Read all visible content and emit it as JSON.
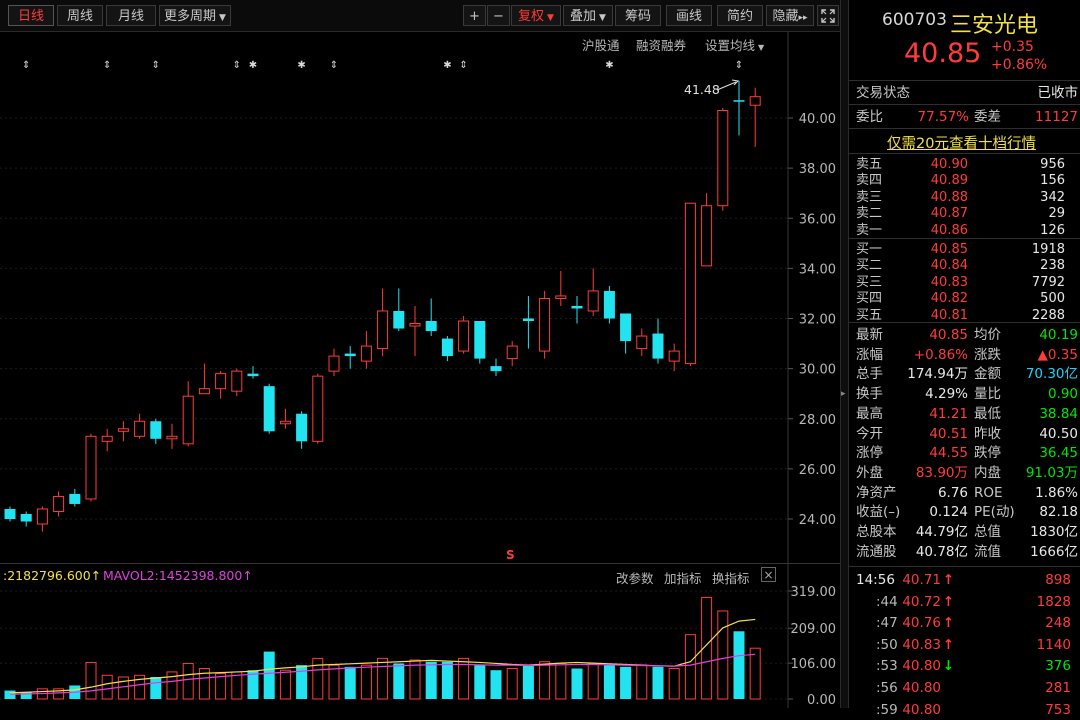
{
  "toolbar": {
    "tabs": [
      "日线",
      "周线",
      "月线",
      "更多周期"
    ],
    "plus": "+",
    "minus": "−",
    "adjust": "复权",
    "overlay": "叠加",
    "chips": "筹码",
    "draw": "画线",
    "simple": "简约",
    "hide": "隐藏",
    "more_arrow": "▸▸"
  },
  "chart_links": {
    "hsgt": "沪股通",
    "margin": "融资融券",
    "ma_settings": "设置均线"
  },
  "markers": {
    "up_arrow_glyph": "⇕",
    "star_glyph": "✱",
    "red_s": "S"
  },
  "volume": {
    "mavol1_label": ":2182796.600",
    "mavol2_label": "MAVOL2:1452398.800",
    "arrow": "↑",
    "params": "改参数",
    "add_indicator": "加指标",
    "switch_indicator": "换指标",
    "close": "×",
    "axis_labels": [
      "319.00",
      "209.00",
      "106.00",
      "0.00"
    ],
    "colors": {
      "ma1": "#f0e04a",
      "ma2": "#e040e0",
      "up": "#ff3b3b",
      "down": "#22e4f0"
    }
  },
  "chart_data": {
    "type": "candlestick",
    "y_axis_labels": [
      "40.00",
      "38.00",
      "36.00",
      "34.00",
      "32.00",
      "30.00",
      "28.00",
      "26.00",
      "24.00"
    ],
    "ylim": [
      23.0,
      42.0
    ],
    "high_annotation": "41.48",
    "candles": [
      {
        "o": 24.0,
        "c": 24.4,
        "h": 24.5,
        "l": 23.9,
        "dir": "down",
        "v": 25
      },
      {
        "o": 23.9,
        "c": 24.2,
        "h": 24.3,
        "l": 23.7,
        "dir": "down",
        "v": 20
      },
      {
        "o": 23.8,
        "c": 24.4,
        "h": 24.5,
        "l": 23.5,
        "dir": "up",
        "v": 30
      },
      {
        "o": 24.3,
        "c": 24.9,
        "h": 25.1,
        "l": 24.1,
        "dir": "up",
        "v": 30
      },
      {
        "o": 25.0,
        "c": 24.6,
        "h": 25.2,
        "l": 24.5,
        "dir": "down",
        "v": 40
      },
      {
        "o": 24.8,
        "c": 27.3,
        "h": 27.4,
        "l": 24.7,
        "dir": "up",
        "v": 108
      },
      {
        "o": 27.1,
        "c": 27.3,
        "h": 27.6,
        "l": 26.7,
        "dir": "up",
        "v": 70
      },
      {
        "o": 27.5,
        "c": 27.6,
        "h": 27.9,
        "l": 27.1,
        "dir": "up",
        "v": 65
      },
      {
        "o": 27.3,
        "c": 27.9,
        "h": 28.2,
        "l": 27.2,
        "dir": "up",
        "v": 70
      },
      {
        "o": 27.9,
        "c": 27.2,
        "h": 28.0,
        "l": 27.0,
        "dir": "down",
        "v": 65
      },
      {
        "o": 27.2,
        "c": 27.3,
        "h": 27.8,
        "l": 26.8,
        "dir": "up",
        "v": 80
      },
      {
        "o": 27.0,
        "c": 28.9,
        "h": 29.5,
        "l": 26.9,
        "dir": "up",
        "v": 105
      },
      {
        "o": 29.0,
        "c": 29.2,
        "h": 30.2,
        "l": 29.0,
        "dir": "up",
        "v": 90
      },
      {
        "o": 29.2,
        "c": 29.8,
        "h": 29.9,
        "l": 28.8,
        "dir": "up",
        "v": 75
      },
      {
        "o": 29.1,
        "c": 29.9,
        "h": 30.0,
        "l": 28.9,
        "dir": "up",
        "v": 80
      },
      {
        "o": 29.8,
        "c": 29.7,
        "h": 30.1,
        "l": 29.6,
        "dir": "down",
        "v": 85
      },
      {
        "o": 29.3,
        "c": 27.5,
        "h": 29.4,
        "l": 27.4,
        "dir": "down",
        "v": 140
      },
      {
        "o": 27.8,
        "c": 27.9,
        "h": 28.4,
        "l": 27.6,
        "dir": "up",
        "v": 85
      },
      {
        "o": 28.2,
        "c": 27.1,
        "h": 28.3,
        "l": 26.8,
        "dir": "down",
        "v": 100
      },
      {
        "o": 27.1,
        "c": 29.7,
        "h": 29.8,
        "l": 27.0,
        "dir": "up",
        "v": 120
      },
      {
        "o": 29.9,
        "c": 30.5,
        "h": 30.8,
        "l": 29.7,
        "dir": "up",
        "v": 100
      },
      {
        "o": 30.5,
        "c": 30.6,
        "h": 30.9,
        "l": 30.0,
        "dir": "down",
        "v": 95
      },
      {
        "o": 30.3,
        "c": 30.9,
        "h": 31.5,
        "l": 30.0,
        "dir": "up",
        "v": 100
      },
      {
        "o": 30.8,
        "c": 32.3,
        "h": 33.2,
        "l": 30.5,
        "dir": "up",
        "v": 120
      },
      {
        "o": 32.3,
        "c": 31.6,
        "h": 33.2,
        "l": 31.5,
        "dir": "down",
        "v": 105
      },
      {
        "o": 31.8,
        "c": 31.7,
        "h": 32.5,
        "l": 30.5,
        "dir": "up",
        "v": 115
      },
      {
        "o": 31.9,
        "c": 31.5,
        "h": 32.8,
        "l": 31.3,
        "dir": "down",
        "v": 110
      },
      {
        "o": 31.2,
        "c": 30.5,
        "h": 31.3,
        "l": 30.3,
        "dir": "down",
        "v": 110
      },
      {
        "o": 30.7,
        "c": 31.9,
        "h": 32.1,
        "l": 30.6,
        "dir": "up",
        "v": 120
      },
      {
        "o": 31.9,
        "c": 30.4,
        "h": 31.9,
        "l": 30.2,
        "dir": "down",
        "v": 100
      },
      {
        "o": 30.1,
        "c": 29.9,
        "h": 30.4,
        "l": 29.7,
        "dir": "down",
        "v": 85
      },
      {
        "o": 30.4,
        "c": 30.9,
        "h": 31.1,
        "l": 30.1,
        "dir": "up",
        "v": 90
      },
      {
        "o": 31.9,
        "c": 32.0,
        "h": 32.9,
        "l": 30.8,
        "dir": "down",
        "v": 100
      },
      {
        "o": 30.7,
        "c": 32.8,
        "h": 33.1,
        "l": 30.4,
        "dir": "up",
        "v": 110
      },
      {
        "o": 32.8,
        "c": 32.9,
        "h": 33.9,
        "l": 32.5,
        "dir": "up",
        "v": 105
      },
      {
        "o": 32.4,
        "c": 32.5,
        "h": 32.9,
        "l": 31.8,
        "dir": "down",
        "v": 90
      },
      {
        "o": 32.3,
        "c": 33.1,
        "h": 34.0,
        "l": 32.1,
        "dir": "up",
        "v": 105
      },
      {
        "o": 33.1,
        "c": 32.0,
        "h": 33.3,
        "l": 31.8,
        "dir": "down",
        "v": 100
      },
      {
        "o": 32.2,
        "c": 31.1,
        "h": 32.2,
        "l": 30.6,
        "dir": "down",
        "v": 95
      },
      {
        "o": 30.8,
        "c": 31.3,
        "h": 31.6,
        "l": 30.5,
        "dir": "up",
        "v": 100
      },
      {
        "o": 31.4,
        "c": 30.4,
        "h": 32.0,
        "l": 30.2,
        "dir": "down",
        "v": 95
      },
      {
        "o": 30.3,
        "c": 30.7,
        "h": 31.0,
        "l": 29.9,
        "dir": "up",
        "v": 90
      },
      {
        "o": 30.2,
        "c": 36.6,
        "h": 36.6,
        "l": 30.1,
        "dir": "up",
        "v": 190
      },
      {
        "o": 34.1,
        "c": 36.5,
        "h": 37.0,
        "l": 34.1,
        "dir": "up",
        "v": 300
      },
      {
        "o": 36.5,
        "c": 40.3,
        "h": 40.4,
        "l": 36.3,
        "dir": "up",
        "v": 260
      },
      {
        "o": 40.71,
        "c": 40.71,
        "h": 41.48,
        "l": 39.3,
        "dir": "down",
        "v": 200
      },
      {
        "o": 40.51,
        "c": 40.85,
        "h": 41.21,
        "l": 38.84,
        "dir": "up",
        "v": 150
      }
    ],
    "ma_series": [
      {
        "name": "MAVOL1",
        "color": "#f0e04a",
        "values": [
          18,
          20,
          22,
          24,
          27,
          35,
          45,
          52,
          58,
          62,
          66,
          72,
          76,
          78,
          80,
          82,
          88,
          92,
          95,
          100,
          102,
          104,
          106,
          108,
          110,
          112,
          114,
          112,
          110,
          108,
          105,
          102,
          100,
          103,
          106,
          108,
          106,
          104,
          102,
          100,
          98,
          97,
          110,
          160,
          210,
          230,
          235
        ]
      },
      {
        "name": "MAVOL2",
        "color": "#e040e0",
        "values": [
          14,
          15,
          16,
          18,
          20,
          24,
          30,
          36,
          42,
          48,
          52,
          58,
          62,
          66,
          70,
          73,
          76,
          79,
          82,
          86,
          89,
          92,
          94,
          96,
          98,
          100,
          101,
          102,
          102,
          101,
          100,
          100,
          99,
          100,
          101,
          102,
          102,
          101,
          100,
          99,
          98,
          97,
          100,
          110,
          120,
          128,
          132
        ]
      }
    ]
  },
  "stock": {
    "code": "600703",
    "name": "三安光电",
    "price": "40.85",
    "change": "+0.35",
    "change_pct": "+0.86%",
    "status_label": "交易状态",
    "status_value": "已收市",
    "webi_label": "委比",
    "webi_value": "77.57%",
    "weicha_label": "委差",
    "weicha_value": "11127",
    "promo": "仅需20元查看十档行情"
  },
  "order_book": {
    "asks": [
      {
        "label": "卖五",
        "price": "40.90",
        "vol": "956"
      },
      {
        "label": "卖四",
        "price": "40.89",
        "vol": "156"
      },
      {
        "label": "卖三",
        "price": "40.88",
        "vol": "342"
      },
      {
        "label": "卖二",
        "price": "40.87",
        "vol": "29"
      },
      {
        "label": "卖一",
        "price": "40.86",
        "vol": "126"
      }
    ],
    "bids": [
      {
        "label": "买一",
        "price": "40.85",
        "vol": "1918"
      },
      {
        "label": "买二",
        "price": "40.84",
        "vol": "238"
      },
      {
        "label": "买三",
        "price": "40.83",
        "vol": "7792"
      },
      {
        "label": "买四",
        "price": "40.82",
        "vol": "500"
      },
      {
        "label": "买五",
        "price": "40.81",
        "vol": "2288"
      }
    ]
  },
  "stats": [
    {
      "l1": "最新",
      "v1": "40.85",
      "c1": "red",
      "l2": "均价",
      "v2": "40.19",
      "c2": "green"
    },
    {
      "l1": "涨幅",
      "v1": "+0.86%",
      "c1": "red",
      "l2": "涨跌",
      "v2": "▲0.35",
      "c2": "red"
    },
    {
      "l1": "总手",
      "v1": "174.94万",
      "c1": "white",
      "l2": "金额",
      "v2": "70.30亿",
      "c2": "cyan"
    },
    {
      "l1": "换手",
      "v1": "4.29%",
      "c1": "white",
      "l2": "量比",
      "v2": "0.90",
      "c2": "green"
    },
    {
      "l1": "最高",
      "v1": "41.21",
      "c1": "red",
      "l2": "最低",
      "v2": "38.84",
      "c2": "green"
    },
    {
      "l1": "今开",
      "v1": "40.51",
      "c1": "red",
      "l2": "昨收",
      "v2": "40.50",
      "c2": "white"
    },
    {
      "l1": "涨停",
      "v1": "44.55",
      "c1": "red",
      "l2": "跌停",
      "v2": "36.45",
      "c2": "green"
    },
    {
      "l1": "外盘",
      "v1": "83.90万",
      "c1": "red",
      "l2": "内盘",
      "v2": "91.03万",
      "c2": "green"
    },
    {
      "l1": "净资产",
      "v1": "6.76",
      "c1": "white",
      "l2": "ROE",
      "v2": "1.86%",
      "c2": "white"
    },
    {
      "l1": "收益(–)",
      "v1": "0.124",
      "c1": "white",
      "l2": "PE(动)",
      "v2": "82.18",
      "c2": "white"
    },
    {
      "l1": "总股本",
      "v1": "44.79亿",
      "c1": "white",
      "l2": "总值",
      "v2": "1830亿",
      "c2": "white"
    },
    {
      "l1": "流通股",
      "v1": "40.78亿",
      "c1": "white",
      "l2": "流值",
      "v2": "1666亿",
      "c2": "white"
    }
  ],
  "ticks": [
    {
      "time": "14:56",
      "price": "40.71",
      "arrow": "↑",
      "dir": "red",
      "vol": "898"
    },
    {
      "time": ":44",
      "price": "40.72",
      "arrow": "↑",
      "dir": "red",
      "vol": "1828"
    },
    {
      "time": ":47",
      "price": "40.76",
      "arrow": "↑",
      "dir": "red",
      "vol": "248"
    },
    {
      "time": ":50",
      "price": "40.83",
      "arrow": "↑",
      "dir": "red",
      "vol": "1140"
    },
    {
      "time": ":53",
      "price": "40.80",
      "arrow": "↓",
      "dir": "green",
      "vol": "376"
    },
    {
      "time": ":56",
      "price": "40.80",
      "arrow": "",
      "dir": "red",
      "vol": "281"
    },
    {
      "time": ":59",
      "price": "40.80",
      "arrow": "",
      "dir": "red",
      "vol": "753"
    }
  ],
  "colors": {
    "up": "#ff3b3b",
    "down": "#22e4f0",
    "axis_text": "#b8b8b8",
    "grid": "#222"
  }
}
